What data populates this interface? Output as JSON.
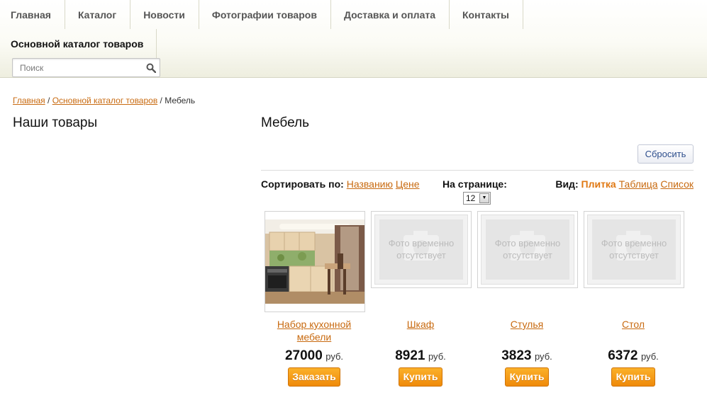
{
  "nav": {
    "items": [
      "Главная",
      "Каталог",
      "Новости",
      "Фотографии товаров",
      "Доставка и оплата",
      "Контакты"
    ],
    "catalog_link": "Основной каталог товаров",
    "search_placeholder": "Поиск"
  },
  "breadcrumb": {
    "home": "Главная",
    "sep1": " / ",
    "catalog": "Основной каталог товаров",
    "sep2": " / ",
    "current": "Мебель"
  },
  "sidebar": {
    "title": "Наши товары"
  },
  "main": {
    "title": "Мебель",
    "reset_label": "Сбросить",
    "sort": {
      "label": "Сортировать по:",
      "by_name": "Названию",
      "by_price": "Цене"
    },
    "per_page": {
      "label": "На странице:",
      "value": "12"
    },
    "view": {
      "label": "Вид:",
      "tile": "Плитка",
      "table": "Таблица",
      "list": "Список"
    }
  },
  "no_photo_text": "Фото временно отсутствует",
  "products": [
    {
      "name": "Набор кухонной мебели",
      "price": "27000",
      "currency": "руб.",
      "button": "Заказать",
      "has_photo": true
    },
    {
      "name": "Шкаф",
      "price": "8921",
      "currency": "руб.",
      "button": "Купить",
      "has_photo": false
    },
    {
      "name": "Стулья",
      "price": "3823",
      "currency": "руб.",
      "button": "Купить",
      "has_photo": false
    },
    {
      "name": "Стол",
      "price": "6372",
      "currency": "руб.",
      "button": "Купить",
      "has_photo": false
    }
  ],
  "colors": {
    "accent": "#e07812",
    "link": "#c86a10",
    "button": "#f39a15",
    "reset_text": "#2e4f8d"
  }
}
